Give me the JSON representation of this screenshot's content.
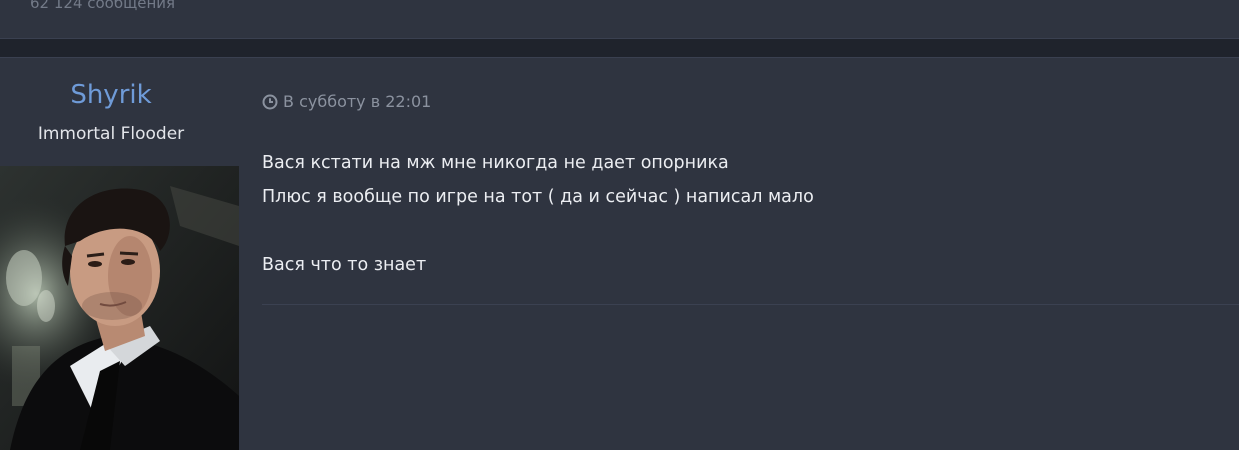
{
  "header": {
    "message_count": "62 124 сообщения"
  },
  "post": {
    "username": "Shyrik",
    "user_title": "Immortal Flooder",
    "timestamp": "В субботу в 22:01",
    "lines": [
      "Вася кстати на мж мне никогда не дает опорника",
      "Плюс я вообще по игре на тот ( да и сейчас ) написал мало",
      "",
      "Вася что то знает"
    ]
  },
  "colors": {
    "background": "#2f3440",
    "username": "#6f9bd8",
    "meta": "#8b929f",
    "text": "#eceef2"
  },
  "icons": {
    "timestamp": "clock-icon"
  }
}
